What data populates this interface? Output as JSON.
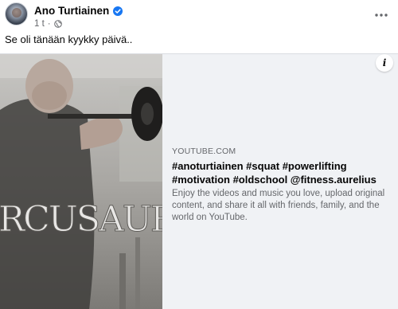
{
  "post": {
    "author": "Ano Turtiainen",
    "time": "1 t",
    "separator": "·",
    "text": "Se oli tänään kyykky päivä.."
  },
  "icons": {
    "verified": "verified-badge-icon",
    "audience": "globe-icon",
    "more": "more-options-icon",
    "info": "info-icon"
  },
  "link_card": {
    "domain": "YOUTUBE.COM",
    "title": "#anoturtiainen #squat #powerlifting #motivation #oldschool @fitness.aurelius",
    "description": "Enjoy the videos and music you love, upload original content, and share it all with friends, family, and the world on YouTube.",
    "info_label": "i",
    "thumbnail_watermark": "RCUSAURELI"
  },
  "colors": {
    "brand_blue": "#1877f2",
    "secondary_text": "#65676b",
    "card_bg": "#f0f2f5"
  }
}
